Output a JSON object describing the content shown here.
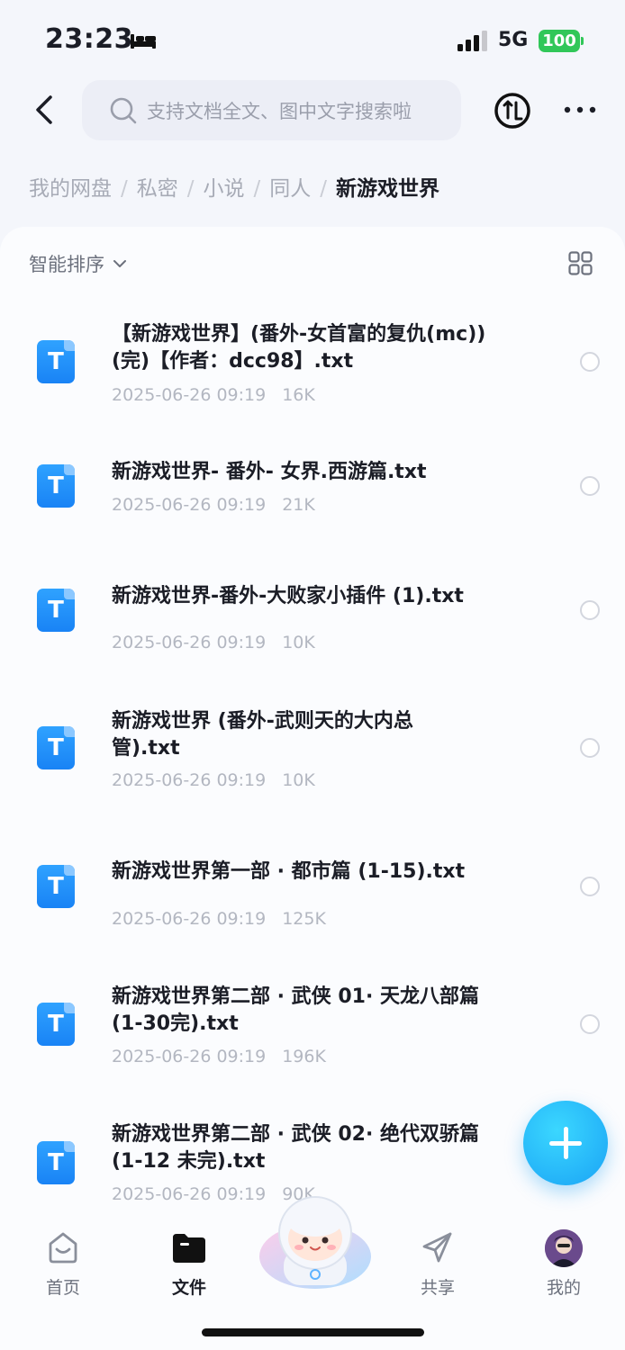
{
  "status_bar": {
    "time": "23:23",
    "network": "5G",
    "battery": "100"
  },
  "search": {
    "placeholder": "支持文档全文、图中文字搜索啦"
  },
  "breadcrumb": [
    "我的网盘",
    "私密",
    "小说",
    "同人"
  ],
  "breadcrumb_current": "新游戏世界",
  "breadcrumb_separator": "/",
  "toolbar": {
    "sort_label": "智能排序"
  },
  "file_icon_letter": "T",
  "files": [
    {
      "name": "【新游戏世界】(番外-女首富的复仇(mc)) (完)【作者：dcc98】.txt",
      "date": "2025-06-26 09:19",
      "size": "16K"
    },
    {
      "name": "新游戏世界- 番外- 女界.西游篇.txt",
      "date": "2025-06-26 09:19",
      "size": "21K"
    },
    {
      "name": "新游戏世界-番外-大败家小插件 (1).txt",
      "date": "2025-06-26 09:19",
      "size": "10K"
    },
    {
      "name": "新游戏世界 (番外-武则天的大内总管).txt",
      "date": "2025-06-26 09:19",
      "size": "10K"
    },
    {
      "name": "新游戏世界第一部 · 都市篇 (1-15).txt",
      "date": "2025-06-26 09:19",
      "size": "125K"
    },
    {
      "name": "新游戏世界第二部 · 武侠 01· 天龙八部篇(1-30完).txt",
      "date": "2025-06-26 09:19",
      "size": "196K"
    },
    {
      "name": "新游戏世界第二部 · 武侠 02· 绝代双骄篇(1-12 未完).txt",
      "date": "2025-06-26 09:19",
      "size": "90K"
    }
  ],
  "bottom_nav": {
    "home": "首页",
    "files": "文件",
    "share": "共享",
    "me": "我的"
  },
  "colors": {
    "accent": "#1a9cf5",
    "file_icon": "#1983f5",
    "battery": "#31c759"
  }
}
